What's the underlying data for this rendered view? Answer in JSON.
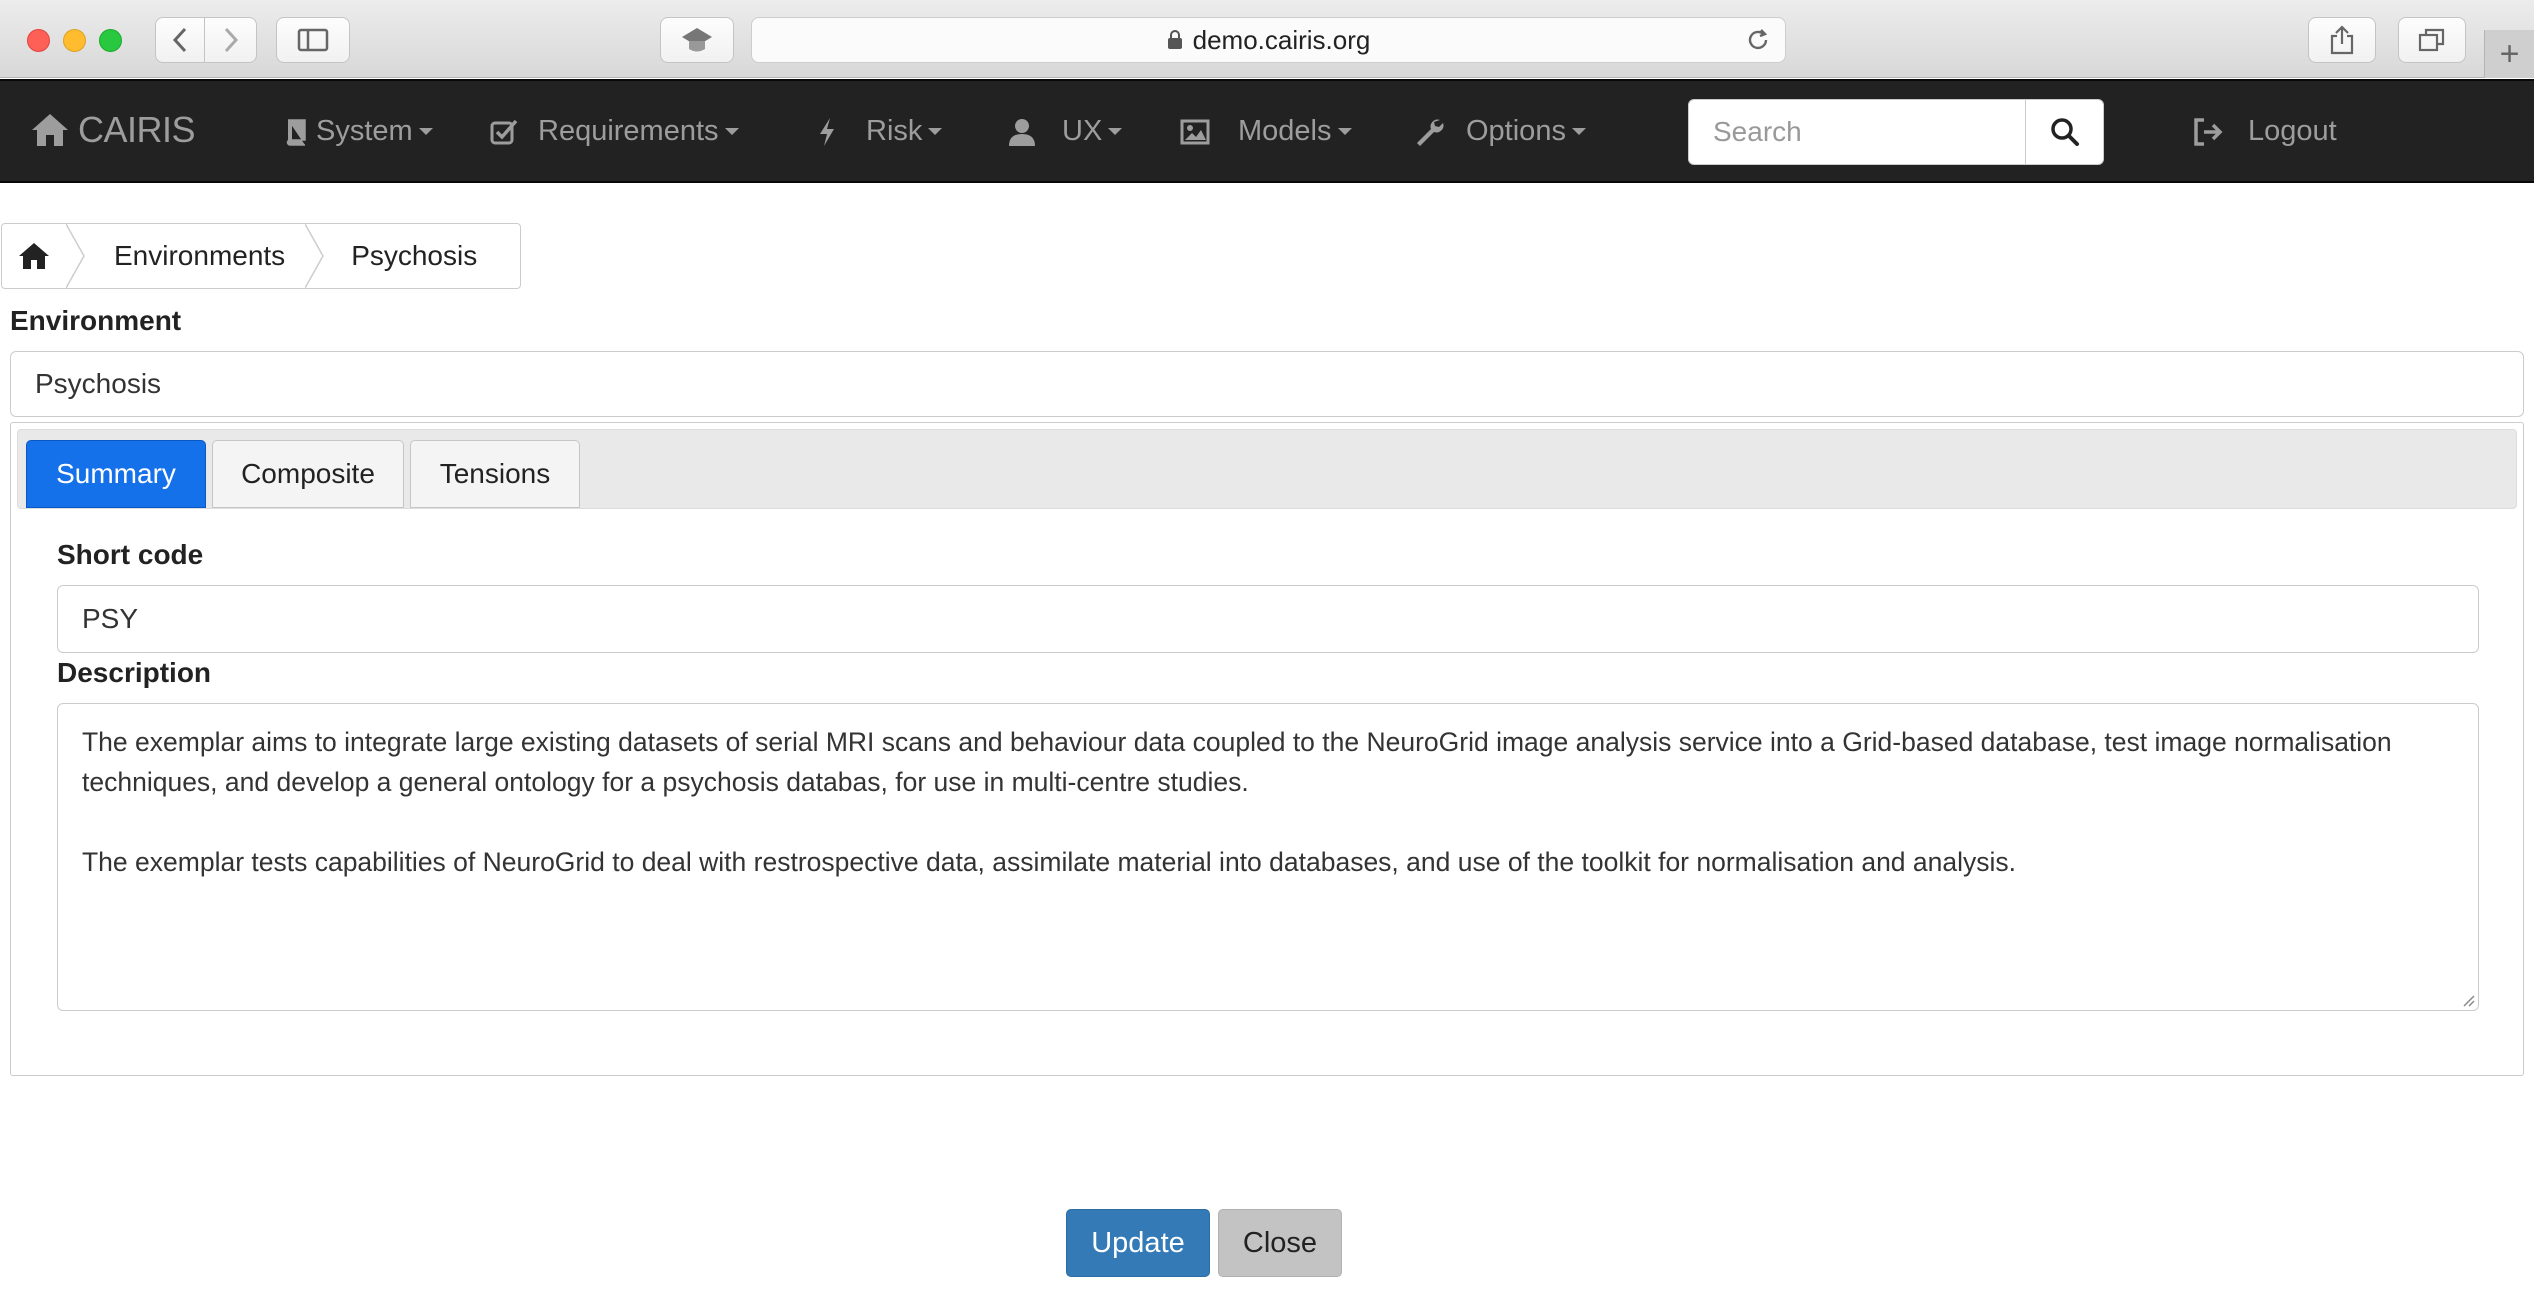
{
  "browser": {
    "url": "demo.cairis.org"
  },
  "navbar": {
    "brand": "CAIRIS",
    "menus": [
      {
        "label": "System",
        "icon": "book-icon"
      },
      {
        "label": "Requirements",
        "icon": "check-square-icon"
      },
      {
        "label": "Risk",
        "icon": "flash-icon"
      },
      {
        "label": "UX",
        "icon": "user-icon"
      },
      {
        "label": "Models",
        "icon": "picture-icon"
      },
      {
        "label": "Options",
        "icon": "wrench-icon"
      }
    ],
    "search": {
      "placeholder": "Search",
      "value": ""
    },
    "logout": "Logout"
  },
  "breadcrumb": {
    "items": [
      "Environments",
      "Psychosis"
    ]
  },
  "form": {
    "environment_label": "Environment",
    "environment_value": "Psychosis",
    "tabs": [
      {
        "label": "Summary",
        "active": true
      },
      {
        "label": "Composite",
        "active": false
      },
      {
        "label": "Tensions",
        "active": false
      }
    ],
    "short_code_label": "Short code",
    "short_code_value": "PSY",
    "description_label": "Description",
    "description_paragraphs": [
      "The exemplar aims to integrate large existing datasets of serial MRI scans and behaviour data coupled to the NeuroGrid image analysis service into a Grid-based database, test image normalisation techniques, and develop a general ontology for a psychosis databas, for use in multi-centre studies.",
      "The exemplar tests capabilities of NeuroGrid to deal with restrospective data, assimilate material into databases, and use of the toolkit for normalisation and analysis."
    ]
  },
  "actions": {
    "update": "Update",
    "close": "Close"
  },
  "colors": {
    "navbar_bg": "#222222",
    "active_tab": "#1471ea",
    "primary_button": "#337ab7",
    "default_button": "#c3c3c3"
  }
}
